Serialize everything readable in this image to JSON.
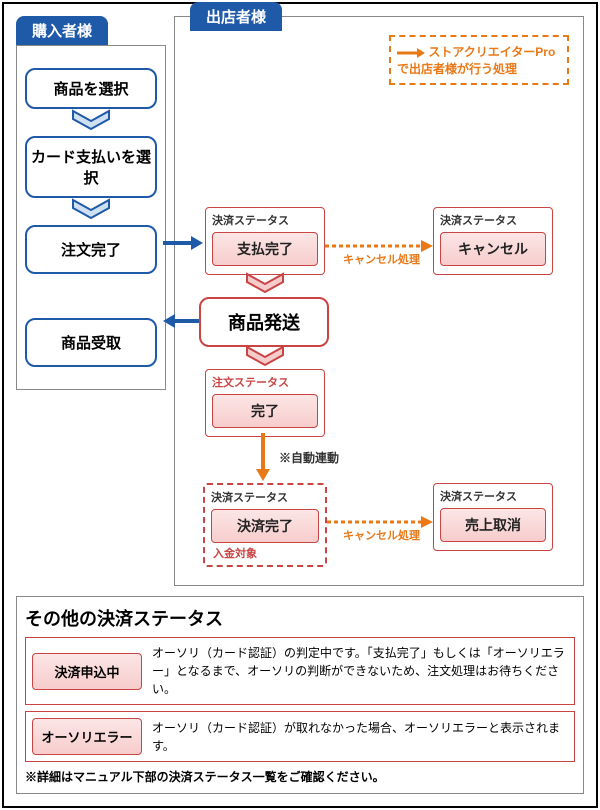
{
  "buyer": {
    "header": "購入者様",
    "steps": [
      "商品を選択",
      "カード支払いを選択",
      "注文完了",
      "商品受取"
    ]
  },
  "seller": {
    "header": "出店者様",
    "legend": "ストアクリエイターProで出店者様が行う処理",
    "pay_status_label": "決済ステータス",
    "order_status_label": "注文ステータス",
    "pay_done": "支払完了",
    "cancel": "キャンセル",
    "ship": "商品発送",
    "complete": "完了",
    "auto_link": "※自動連動",
    "settle_done": "決済完了",
    "deposit_target": "入金対象",
    "sales_cancel": "売上取消",
    "cancel_proc": "キャンセル処理"
  },
  "bottom": {
    "title": "その他の決済ステータス",
    "rows": [
      {
        "label": "決済申込中",
        "text": "オーソリ（カード認証）の判定中です。「支払完了」もしくは「オーソリエラー」となるまで、オーソリの判断ができないため、注文処理はお待ちください。"
      },
      {
        "label": "オーソリエラー",
        "text": "オーソリ（カード認証）が取れなかった場合、オーソリエラーと表示されます。"
      }
    ],
    "note": "※詳細はマニュアル下部の決済ステータス一覧をご確認ください。"
  }
}
